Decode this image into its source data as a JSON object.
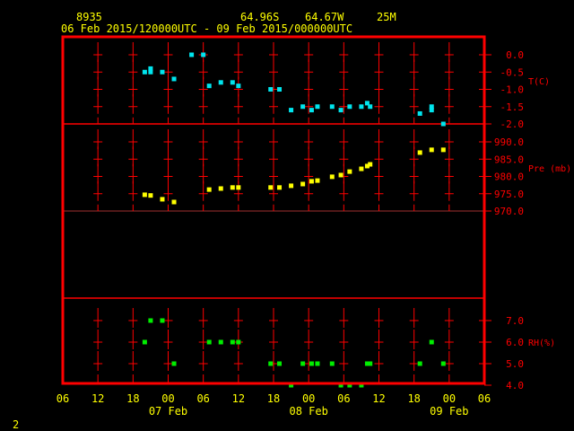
{
  "header": {
    "station": "8935",
    "lat": "64.96S",
    "lon": "64.67W",
    "elev": "25M",
    "period": "06 Feb 2015/120000UTC - 09 Feb 2015/000000UTC"
  },
  "page_number": "2",
  "colors": {
    "frame": "#ff0000",
    "text": "#ffff00",
    "temperature": "#00e5ee",
    "pressure": "#ffff00",
    "rh": "#00ee00",
    "background": "#000000"
  },
  "chart_data": [
    {
      "type": "scatter",
      "ylabel": "T(C)",
      "ylim": [
        -2.0,
        0.0
      ],
      "yticks": [
        "0.0",
        "-0.5",
        "-1.0",
        "-1.5",
        "-2.0"
      ],
      "x": [
        "2015-02-06T20:00",
        "2015-02-06T21:00",
        "2015-02-06T21:00",
        "2015-02-06T23:00",
        "2015-02-07T01:00",
        "2015-02-07T04:00",
        "2015-02-07T06:00",
        "2015-02-07T07:00",
        "2015-02-07T09:00",
        "2015-02-07T11:00",
        "2015-02-07T12:00",
        "2015-02-07T17:30",
        "2015-02-07T19:00",
        "2015-02-07T21:00",
        "2015-02-07T23:00",
        "2015-02-08T00:30",
        "2015-02-08T01:30",
        "2015-02-08T04:00",
        "2015-02-08T05:30",
        "2015-02-08T07:00",
        "2015-02-08T09:00",
        "2015-02-08T10:00",
        "2015-02-08T10:30",
        "2015-02-08T19:00",
        "2015-02-08T21:00",
        "2015-02-08T21:00",
        "2015-02-08T23:00"
      ],
      "values": [
        -0.5,
        -0.4,
        -0.5,
        -0.5,
        -0.7,
        0.0,
        0.0,
        -0.9,
        -0.8,
        -0.8,
        -0.9,
        -1.0,
        -1.0,
        -1.6,
        -1.5,
        -1.6,
        -1.5,
        -1.5,
        -1.6,
        -1.5,
        -1.5,
        -1.4,
        -1.5,
        -1.7,
        -1.5,
        -1.6,
        -2.0
      ]
    },
    {
      "type": "scatter",
      "ylabel": "Pre (mb)",
      "ylim": [
        970.0,
        990.0
      ],
      "yticks": [
        "990.0",
        "985.0",
        "980.0",
        "975.0",
        "970.0"
      ],
      "x": [
        "2015-02-06T20:00",
        "2015-02-06T21:00",
        "2015-02-06T23:00",
        "2015-02-07T01:00",
        "2015-02-07T07:00",
        "2015-02-07T09:00",
        "2015-02-07T11:00",
        "2015-02-07T12:00",
        "2015-02-07T17:30",
        "2015-02-07T19:00",
        "2015-02-07T21:00",
        "2015-02-07T23:00",
        "2015-02-08T00:30",
        "2015-02-08T01:30",
        "2015-02-08T04:00",
        "2015-02-08T05:30",
        "2015-02-08T07:00",
        "2015-02-08T09:00",
        "2015-02-08T10:00",
        "2015-02-08T10:30",
        "2015-02-08T19:00",
        "2015-02-08T21:00",
        "2015-02-08T23:00"
      ],
      "values": [
        974.7,
        974.5,
        973.4,
        972.6,
        976.2,
        976.5,
        976.8,
        976.8,
        976.8,
        976.8,
        977.3,
        977.8,
        978.6,
        978.8,
        979.9,
        980.4,
        981.4,
        982.2,
        983.0,
        983.5,
        986.9,
        987.7,
        987.7
      ]
    },
    {
      "type": "scatter",
      "ylabel": "RH(%)",
      "ylim": [
        4.0,
        7.0
      ],
      "yticks": [
        "7.0",
        "6.0",
        "5.0",
        "4.0"
      ],
      "x": [
        "2015-02-06T20:00",
        "2015-02-06T21:00",
        "2015-02-06T23:00",
        "2015-02-07T01:00",
        "2015-02-07T07:00",
        "2015-02-07T09:00",
        "2015-02-07T11:00",
        "2015-02-07T12:00",
        "2015-02-07T17:30",
        "2015-02-07T19:00",
        "2015-02-07T21:00",
        "2015-02-07T23:00",
        "2015-02-08T00:30",
        "2015-02-08T01:30",
        "2015-02-08T04:00",
        "2015-02-08T05:30",
        "2015-02-08T07:00",
        "2015-02-08T09:00",
        "2015-02-08T10:00",
        "2015-02-08T10:30",
        "2015-02-08T19:00",
        "2015-02-08T21:00",
        "2015-02-08T23:00"
      ],
      "values": [
        6,
        7,
        7,
        5,
        6,
        6,
        6,
        6,
        5,
        5,
        4,
        5,
        5,
        5,
        5,
        4,
        4,
        4,
        5,
        5,
        5,
        6,
        5
      ]
    }
  ],
  "xaxis": {
    "start": "2015-02-06T06:00",
    "end": "2015-02-09T06:00",
    "tick_labels": [
      "06",
      "12",
      "18",
      "00",
      "06",
      "12",
      "18",
      "00",
      "06",
      "12",
      "18",
      "00",
      "06"
    ],
    "date_labels": [
      {
        "label": "07 Feb",
        "at": "2015-02-07T00:00"
      },
      {
        "label": "08 Feb",
        "at": "2015-02-08T00:00"
      },
      {
        "label": "09 Feb",
        "at": "2015-02-09T00:00"
      }
    ]
  }
}
